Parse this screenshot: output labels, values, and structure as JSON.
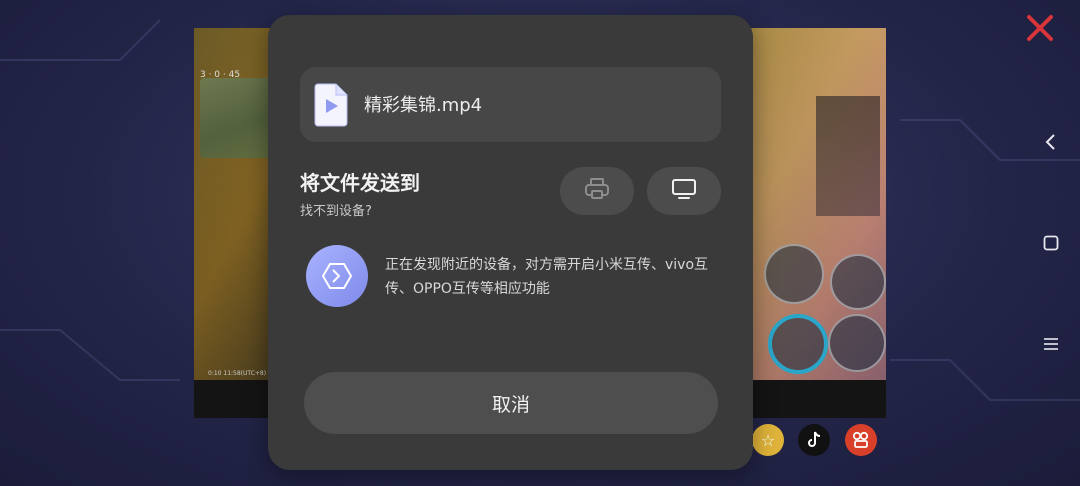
{
  "dialog": {
    "file_name": "精彩集锦.mp4",
    "send_title": "将文件发送到",
    "no_device_link": "找不到设备?",
    "discover_text": "正在发现附近的设备，对方需开启小米互传、vivo互传、OPPO互传等相应功能",
    "cancel_label": "取消",
    "target_buttons": [
      {
        "icon": "printer-icon"
      },
      {
        "icon": "tv-icon"
      }
    ]
  },
  "background_video": {
    "hud_stats": "3 · 0 · 45",
    "timestamp": "0:10 11:58(UTC+8)"
  },
  "nav_bar": {
    "icons": [
      "back-icon",
      "home-icon",
      "menu-icon"
    ]
  },
  "colors": {
    "sheet_bg": "#3a3a3a",
    "accent_purple": "#8f9af0",
    "close_red": "#d8343a"
  }
}
